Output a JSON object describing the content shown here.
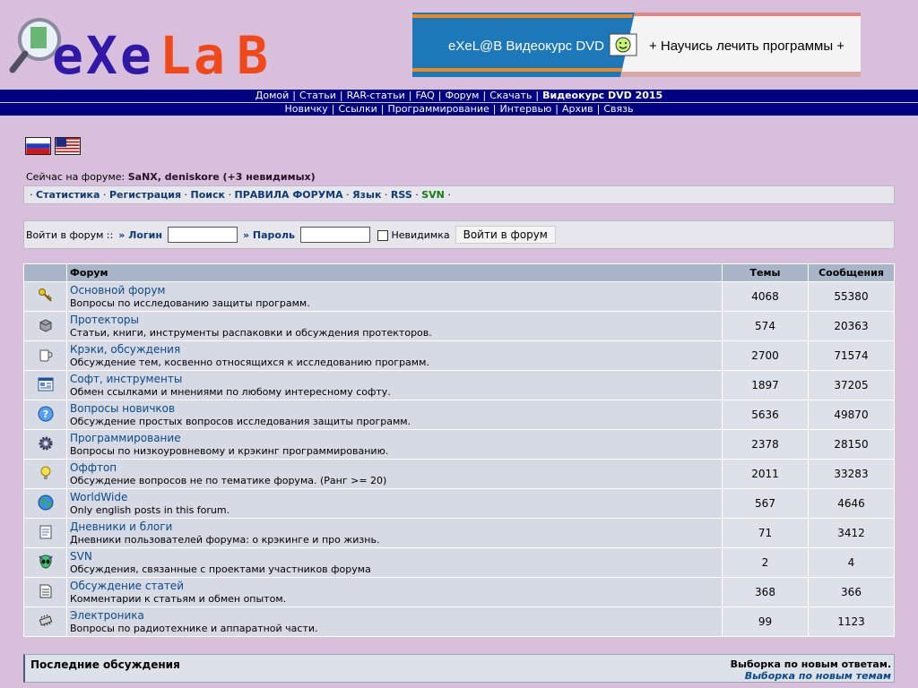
{
  "logo": {
    "text": "eXeL@B"
  },
  "banner": {
    "left_text": "eXeL@B Видеокурс DVD",
    "right_text": "+ Научись лечить программы +"
  },
  "nav_primary": [
    {
      "label": "Домой"
    },
    {
      "label": "Статьи"
    },
    {
      "label": "RAR-статьи"
    },
    {
      "label": "FAQ"
    },
    {
      "label": "Форум"
    },
    {
      "label": "Скачать"
    },
    {
      "label": "Видеокурс DVD 2015",
      "bold": true
    }
  ],
  "nav_secondary": [
    {
      "label": "Новичку"
    },
    {
      "label": "Ссылки"
    },
    {
      "label": "Программирование"
    },
    {
      "label": "Интервью"
    },
    {
      "label": "Архив"
    },
    {
      "label": "Связь"
    }
  ],
  "online": {
    "prefix": "Сейчас на форуме:",
    "users": "SaNX, deniskore (+3 невидимых)"
  },
  "links_bar": {
    "items": [
      "Статистика",
      "Регистрация",
      "Поиск",
      "ПРАВИЛА ФОРУМА",
      "Язык",
      "RSS",
      "SVN"
    ]
  },
  "login": {
    "prefix": "Войти в форум ::",
    "login_label": "» Логин",
    "password_label": "» Пароль",
    "invisible_label": "Невидимка",
    "button": "Войти в форум"
  },
  "table_headers": {
    "forum": "Форум",
    "topics": "Темы",
    "posts": "Сообщения"
  },
  "forums": [
    {
      "icon": "key-icon",
      "title": "Основной форум",
      "desc": "Вопросы по исследованию защиты программ.",
      "topics": "4068",
      "posts": "55380"
    },
    {
      "icon": "box-icon",
      "title": "Протекторы",
      "desc": "Статьи, книги, инструменты распаковки и обсуждения протекторов.",
      "topics": "574",
      "posts": "20363"
    },
    {
      "icon": "cup-icon",
      "title": "Крэки, обсуждения",
      "desc": "Обсуждение тем, косвенно относящихся к исследованию программ.",
      "topics": "2700",
      "posts": "71574"
    },
    {
      "icon": "window-icon",
      "title": "Софт, инструменты",
      "desc": "Обмен ссылками и мнениями по любому интересному софту.",
      "topics": "1897",
      "posts": "37205"
    },
    {
      "icon": "help-icon",
      "title": "Вопросы новичков",
      "desc": "Обсуждение простых вопросов исследования защиты программ.",
      "topics": "5636",
      "posts": "49870"
    },
    {
      "icon": "gear-icon",
      "title": "Программирование",
      "desc": "Вопросы по низкоуровневому и крэкинг программированию.",
      "topics": "2378",
      "posts": "28150"
    },
    {
      "icon": "bulb-icon",
      "title": "Оффтоп",
      "desc": "Обсуждение вопросов не по тематике форума. (Ранг >= 20)",
      "topics": "2011",
      "posts": "33283"
    },
    {
      "icon": "globe-icon",
      "title": "WorldWide",
      "desc": "Only english posts in this forum.",
      "topics": "567",
      "posts": "4646"
    },
    {
      "icon": "notepad-icon",
      "title": "Дневники и блоги",
      "desc": "Дневники пользователей форума: о крэкинге и про жизнь.",
      "topics": "71",
      "posts": "3412"
    },
    {
      "icon": "alien-icon",
      "title": "SVN",
      "desc": "Обсуждения, связанные с проектами участников форума",
      "topics": "2",
      "posts": "4"
    },
    {
      "icon": "document-icon",
      "title": "Обсуждение статей",
      "desc": "Комментарии к статьям и обмен опытом.",
      "topics": "368",
      "posts": "366"
    },
    {
      "icon": "chip-icon",
      "title": "Электроника",
      "desc": "Вопросы по радиотехнике и аппаратной части.",
      "topics": "99",
      "posts": "1123"
    }
  ],
  "recent": {
    "title": "Последние обсуждения",
    "link1": "Выборка по новым ответам.",
    "link2": "Выборка по новым темам"
  }
}
